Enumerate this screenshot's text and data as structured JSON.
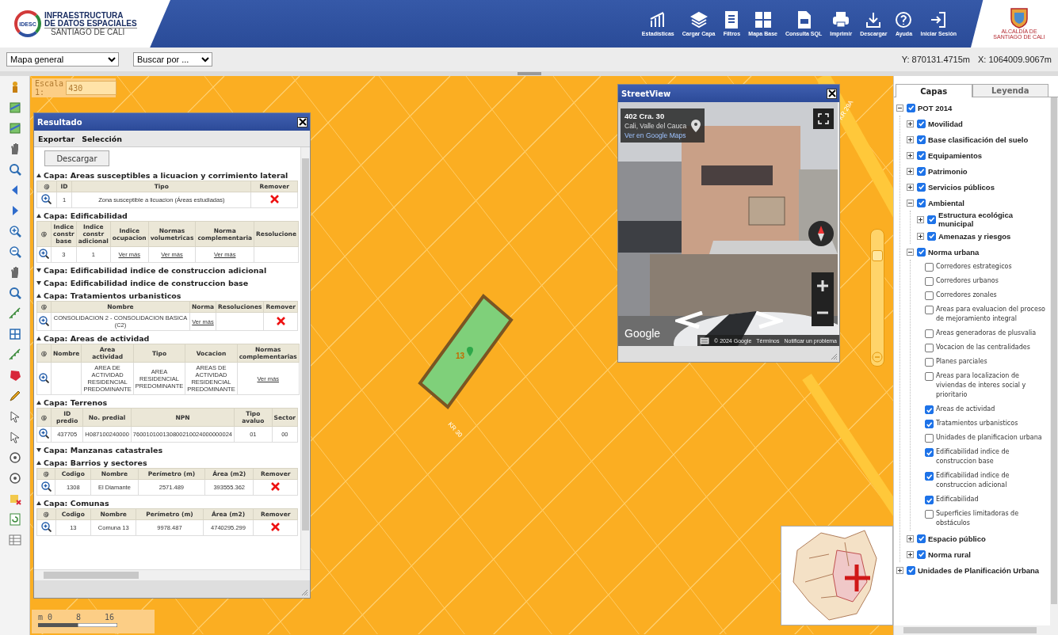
{
  "header": {
    "logo_badge": "IDESC",
    "logo_lines": [
      "INFRAESTRUCTURA",
      "DE DATOS ESPACIALES",
      "SANTIAGO DE CALI"
    ],
    "tools": [
      {
        "label": "Estadísticas"
      },
      {
        "label": "Cargar Capa"
      },
      {
        "label": "Filtros"
      },
      {
        "label": "Mapa Base"
      },
      {
        "label": "Consulta SQL"
      },
      {
        "label": "Imprimir"
      },
      {
        "label": "Descargar"
      },
      {
        "label": "Ayuda"
      },
      {
        "label": "Iniciar Sesión"
      }
    ],
    "city_logo_lines": [
      "ALCALDÍA DE",
      "SANTIAGO DE CALI"
    ]
  },
  "toolbar": {
    "map_select": "Mapa general",
    "search_select": "Buscar por ...",
    "coord_y": "Y: 870131.4715m",
    "coord_x": "X: 1064009.9067m"
  },
  "map": {
    "scale_label": "Escala 1:",
    "scale_value": "430",
    "parcel_label": "13",
    "road_labels": [
      "KR 30",
      "KR 29A"
    ],
    "scale_bar_labels": [
      "m 0",
      "8",
      "16"
    ],
    "zoom_slider": {
      "level": 0.83
    }
  },
  "result_window": {
    "title": "Resultado",
    "menu": [
      "Exportar",
      "Selección"
    ],
    "download_button": "Descargar",
    "layers": [
      {
        "title": "Capa: Areas susceptibles a licuacion y corrimiento lateral",
        "expanded": true,
        "columns": [
          "@",
          "ID",
          "Tipo",
          "Remover"
        ],
        "rows": [
          [
            {
              "kind": "zoom"
            },
            {
              "kind": "text",
              "text": "1"
            },
            {
              "kind": "text",
              "text": "Zona susceptible a licuacion (Áreas estudiadas)"
            },
            {
              "kind": "remove"
            }
          ]
        ]
      },
      {
        "title": "Capa: Edificabilidad",
        "expanded": true,
        "columns": [
          "@",
          "Indice constr base",
          "Indice constr adicional",
          "Indice ocupacion",
          "Normas volumetricas",
          "Norma complementaria",
          "Resolucione"
        ],
        "rows": [
          [
            {
              "kind": "zoom"
            },
            {
              "kind": "text",
              "text": "3"
            },
            {
              "kind": "text",
              "text": "1"
            },
            {
              "kind": "link",
              "text": "Ver más"
            },
            {
              "kind": "link",
              "text": "Ver más"
            },
            {
              "kind": "link",
              "text": "Ver más"
            },
            {
              "kind": "empty"
            }
          ]
        ]
      },
      {
        "title": "Capa: Edificabilidad indice de construccion adicional",
        "expanded": false
      },
      {
        "title": "Capa: Edificabilidad indice de construccion base",
        "expanded": false
      },
      {
        "title": "Capa: Tratamientos urbanisticos",
        "expanded": true,
        "columns": [
          "@",
          "Nombre",
          "Norma",
          "Resoluciones",
          "Remover"
        ],
        "rows": [
          [
            {
              "kind": "zoom"
            },
            {
              "kind": "text",
              "text": "CONSOLIDACION 2 - CONSOLIDACION BASICA (C2)"
            },
            {
              "kind": "link",
              "text": "Ver más"
            },
            {
              "kind": "empty"
            },
            {
              "kind": "remove"
            }
          ]
        ]
      },
      {
        "title": "Capa: Areas de actividad",
        "expanded": true,
        "columns": [
          "@",
          "Nombre",
          "Area actividad",
          "Tipo",
          "Vocacion",
          "Normas complementarias"
        ],
        "rows": [
          [
            {
              "kind": "zoom"
            },
            {
              "kind": "empty"
            },
            {
              "kind": "text",
              "text": "AREA DE ACTIVIDAD RESIDENCIAL PREDOMINANTE"
            },
            {
              "kind": "text",
              "text": "AREA RESIDENCIAL PREDOMINANTE"
            },
            {
              "kind": "text",
              "text": "AREAS DE ACTIVIDAD RESIDENCIAL PREDOMINANTE"
            },
            {
              "kind": "link",
              "text": "Ver más"
            }
          ]
        ]
      },
      {
        "title": "Capa: Terrenos",
        "expanded": true,
        "columns": [
          "@",
          "ID predio",
          "No. predial",
          "NPN",
          "Tipo avaluo",
          "Sector"
        ],
        "rows": [
          [
            {
              "kind": "zoom"
            },
            {
              "kind": "text",
              "text": "437705"
            },
            {
              "kind": "text",
              "text": "H087100240000"
            },
            {
              "kind": "text",
              "text": "760010100130800210024000000024"
            },
            {
              "kind": "text",
              "text": "01"
            },
            {
              "kind": "text",
              "text": "00"
            }
          ]
        ]
      },
      {
        "title": "Capa: Manzanas catastrales",
        "expanded": false
      },
      {
        "title": "Capa: Barrios y sectores",
        "expanded": true,
        "columns": [
          "@",
          "Codigo",
          "Nombre",
          "Perímetro (m)",
          "Área (m2)",
          "Remover"
        ],
        "rows": [
          [
            {
              "kind": "zoom"
            },
            {
              "kind": "text",
              "text": "1308"
            },
            {
              "kind": "text",
              "text": "El Diamante"
            },
            {
              "kind": "text",
              "text": "2571.489"
            },
            {
              "kind": "text",
              "text": "393555.362"
            },
            {
              "kind": "remove"
            }
          ]
        ]
      },
      {
        "title": "Capa: Comunas",
        "expanded": true,
        "columns": [
          "@",
          "Codigo",
          "Nombre",
          "Perímetro (m)",
          "Área (m2)",
          "Remover"
        ],
        "rows": [
          [
            {
              "kind": "zoom"
            },
            {
              "kind": "text",
              "text": "13"
            },
            {
              "kind": "text",
              "text": "Comuna 13"
            },
            {
              "kind": "text",
              "text": "9978.487"
            },
            {
              "kind": "text",
              "text": "4740295.299"
            },
            {
              "kind": "remove"
            }
          ]
        ]
      }
    ]
  },
  "streetview": {
    "title": "StreetView",
    "address": "402 Cra. 30",
    "city": "Cali, Valle del Cauca",
    "maps_link": "Ver en Google Maps",
    "brand": "Google",
    "footer": [
      "© 2024 Google",
      "Términos",
      "Notificar un problema"
    ]
  },
  "layers_panel": {
    "tabs": [
      {
        "label": "Capas",
        "selected": true
      },
      {
        "label": "Leyenda",
        "selected": false
      }
    ],
    "tree": [
      {
        "label": "POT 2014",
        "kind": "group",
        "checked": true,
        "expanded": true,
        "children": [
          {
            "label": "Movilidad",
            "kind": "group",
            "checked": true,
            "expanded": false
          },
          {
            "label": "Base clasificación del suelo",
            "kind": "group",
            "checked": true,
            "expanded": false
          },
          {
            "label": "Equipamientos",
            "kind": "group",
            "checked": true,
            "expanded": false
          },
          {
            "label": "Patrimonio",
            "kind": "group",
            "checked": true,
            "expanded": false
          },
          {
            "label": "Servicios públicos",
            "kind": "group",
            "checked": true,
            "expanded": false
          },
          {
            "label": "Ambiental",
            "kind": "group",
            "checked": true,
            "expanded": true,
            "children": [
              {
                "label": "Estructura ecológica municipal",
                "kind": "group",
                "checked": true,
                "expanded": false
              },
              {
                "label": "Amenazas y riesgos",
                "kind": "group",
                "checked": true,
                "expanded": false
              }
            ]
          },
          {
            "label": "Norma urbana",
            "kind": "group",
            "checked": true,
            "expanded": true,
            "children": [
              {
                "label": "Corredores estrategicos",
                "kind": "layer",
                "checked": false
              },
              {
                "label": "Corredores urbanos",
                "kind": "layer",
                "checked": false
              },
              {
                "label": "Corredores zonales",
                "kind": "layer",
                "checked": false
              },
              {
                "label": "Areas para evaluacion del proceso de mejoramiento integral",
                "kind": "layer",
                "checked": false
              },
              {
                "label": "Areas generadoras de plusvalia",
                "kind": "layer",
                "checked": false
              },
              {
                "label": "Vocacion de las centralidades",
                "kind": "layer",
                "checked": false
              },
              {
                "label": "Planes parciales",
                "kind": "layer",
                "checked": false
              },
              {
                "label": "Areas para localizacion de viviendas de interes social y prioritario",
                "kind": "layer",
                "checked": false
              },
              {
                "label": "Areas de actividad",
                "kind": "layer",
                "checked": true
              },
              {
                "label": "Tratamientos urbanisticos",
                "kind": "layer",
                "checked": true
              },
              {
                "label": "Unidades de planificacion urbana",
                "kind": "layer",
                "checked": false
              },
              {
                "label": "Edificabilidad indice de construccion base",
                "kind": "layer",
                "checked": true
              },
              {
                "label": "Edificabilidad indice de construccion adicional",
                "kind": "layer",
                "checked": true
              },
              {
                "label": "Edificabilidad",
                "kind": "layer",
                "checked": true
              },
              {
                "label": "Superficies limitadoras de obstáculos",
                "kind": "layer",
                "checked": false
              }
            ]
          },
          {
            "label": "Espacio público",
            "kind": "group",
            "checked": true,
            "expanded": false
          },
          {
            "label": "Norma rural",
            "kind": "group",
            "checked": true,
            "expanded": false
          }
        ]
      },
      {
        "label": "Unidades de Planificación Urbana",
        "kind": "group",
        "checked": true,
        "expanded": false
      }
    ]
  }
}
